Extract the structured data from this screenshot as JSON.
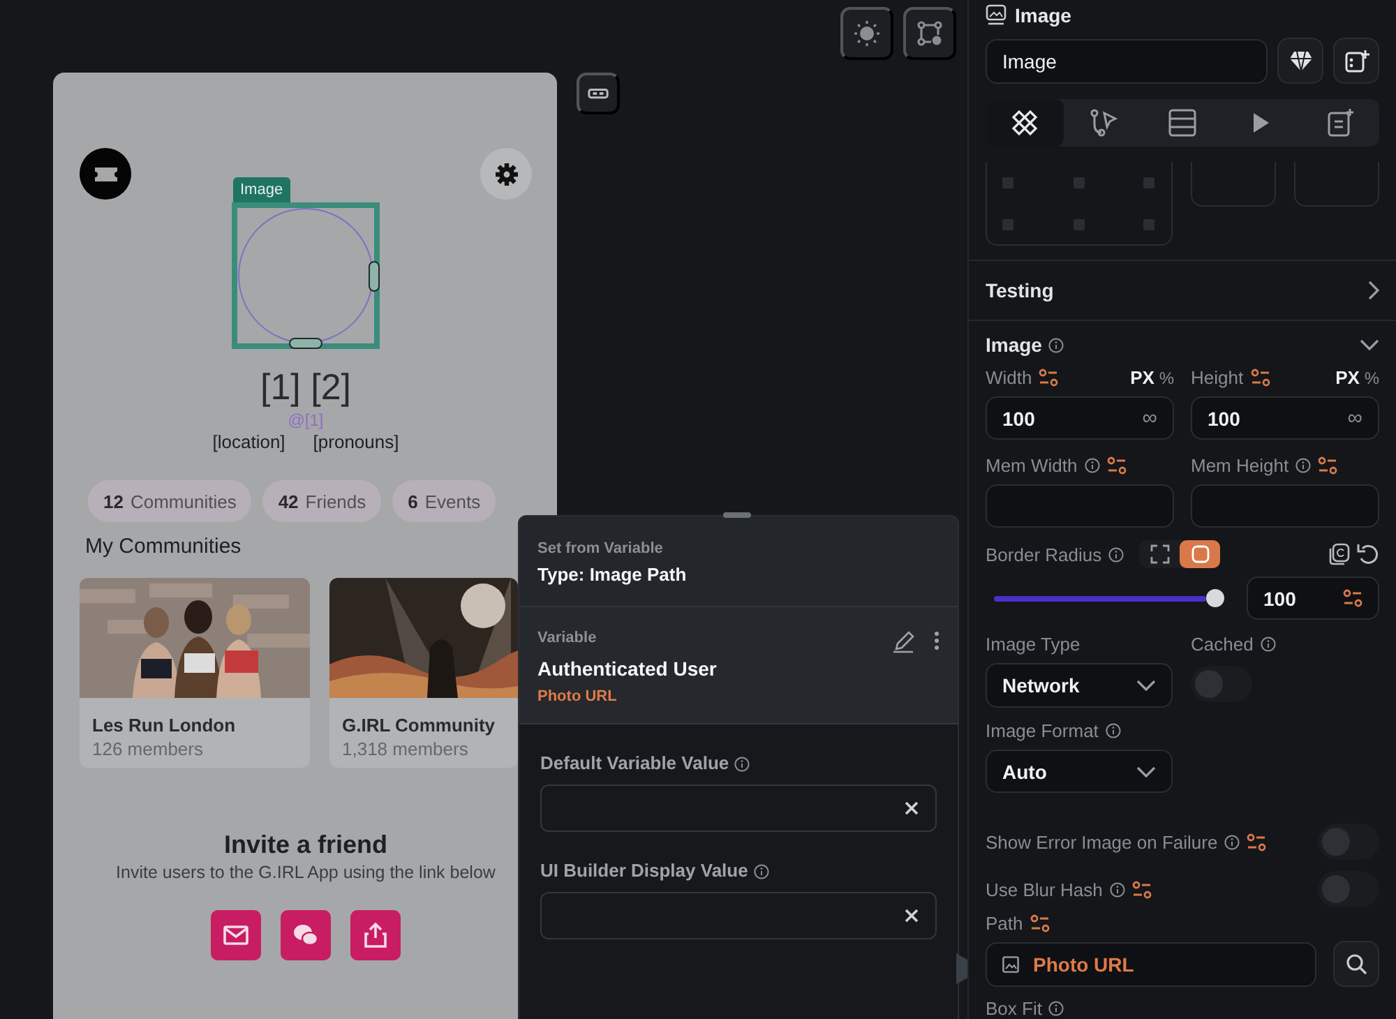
{
  "phone": {
    "image_label": "Image",
    "name": "[1] [2]",
    "handle": "@[1]",
    "location": "[location]",
    "pronouns": "[pronouns]",
    "stats": [
      {
        "count": "12",
        "label": "Communities"
      },
      {
        "count": "42",
        "label": "Friends"
      },
      {
        "count": "6",
        "label": "Events"
      }
    ],
    "section_title": "My Communities",
    "communities": [
      {
        "name": "Les Run London",
        "members": "126 members",
        "kind": "group"
      },
      {
        "name": "G.IRL Community",
        "members": "1,318 members",
        "kind": "concert"
      }
    ],
    "invite": {
      "title": "Invite a friend",
      "text": "Invite users to the G.IRL App using the link below"
    },
    "share_buttons": [
      {
        "kind": "mail"
      },
      {
        "kind": "chat"
      },
      {
        "kind": "share"
      }
    ]
  },
  "variable_popup": {
    "header_label": "Set from Variable",
    "type": "Type: Image Path",
    "variable_label": "Variable",
    "variable_name": "Authenticated User",
    "field": "Photo URL",
    "inputs": [
      {
        "label": "Default Variable Value"
      },
      {
        "label": "UI Builder Display Value"
      }
    ]
  },
  "properties_panel": {
    "title": "Image",
    "name_value": "Image",
    "tabs": [
      {
        "kind": "style",
        "selected": true
      },
      {
        "kind": "actions",
        "selected": false
      },
      {
        "kind": "data",
        "selected": false
      },
      {
        "kind": "play",
        "selected": false
      },
      {
        "kind": "notes",
        "selected": false
      }
    ],
    "testing": "Testing",
    "section": "Image",
    "size": [
      {
        "label": "Width",
        "unit": "PX",
        "alt_unit": "%",
        "value": "100",
        "suffix": "∞"
      },
      {
        "label": "Height",
        "unit": "PX",
        "alt_unit": "%",
        "value": "100",
        "suffix": "∞"
      }
    ],
    "mem_size": [
      {
        "label": "Mem Width"
      },
      {
        "label": "Mem Height"
      }
    ],
    "border_radius": {
      "label": "Border Radius",
      "modes": [
        {
          "kind": "corners",
          "selected": false
        },
        {
          "kind": "uniform",
          "selected": true
        }
      ],
      "level": 1.0,
      "value": "100"
    },
    "image_type": {
      "label": "Image Type",
      "value": "Network"
    },
    "cached": {
      "label": "Cached",
      "on": false
    },
    "image_format": {
      "label": "Image Format",
      "value": "Auto"
    },
    "toggles": [
      {
        "label": "Show Error Image on Failure",
        "on": false
      },
      {
        "label": "Use Blur Hash",
        "on": false
      }
    ],
    "path": {
      "label": "Path",
      "value": "Photo URL"
    },
    "box_fit": "Box Fit"
  }
}
